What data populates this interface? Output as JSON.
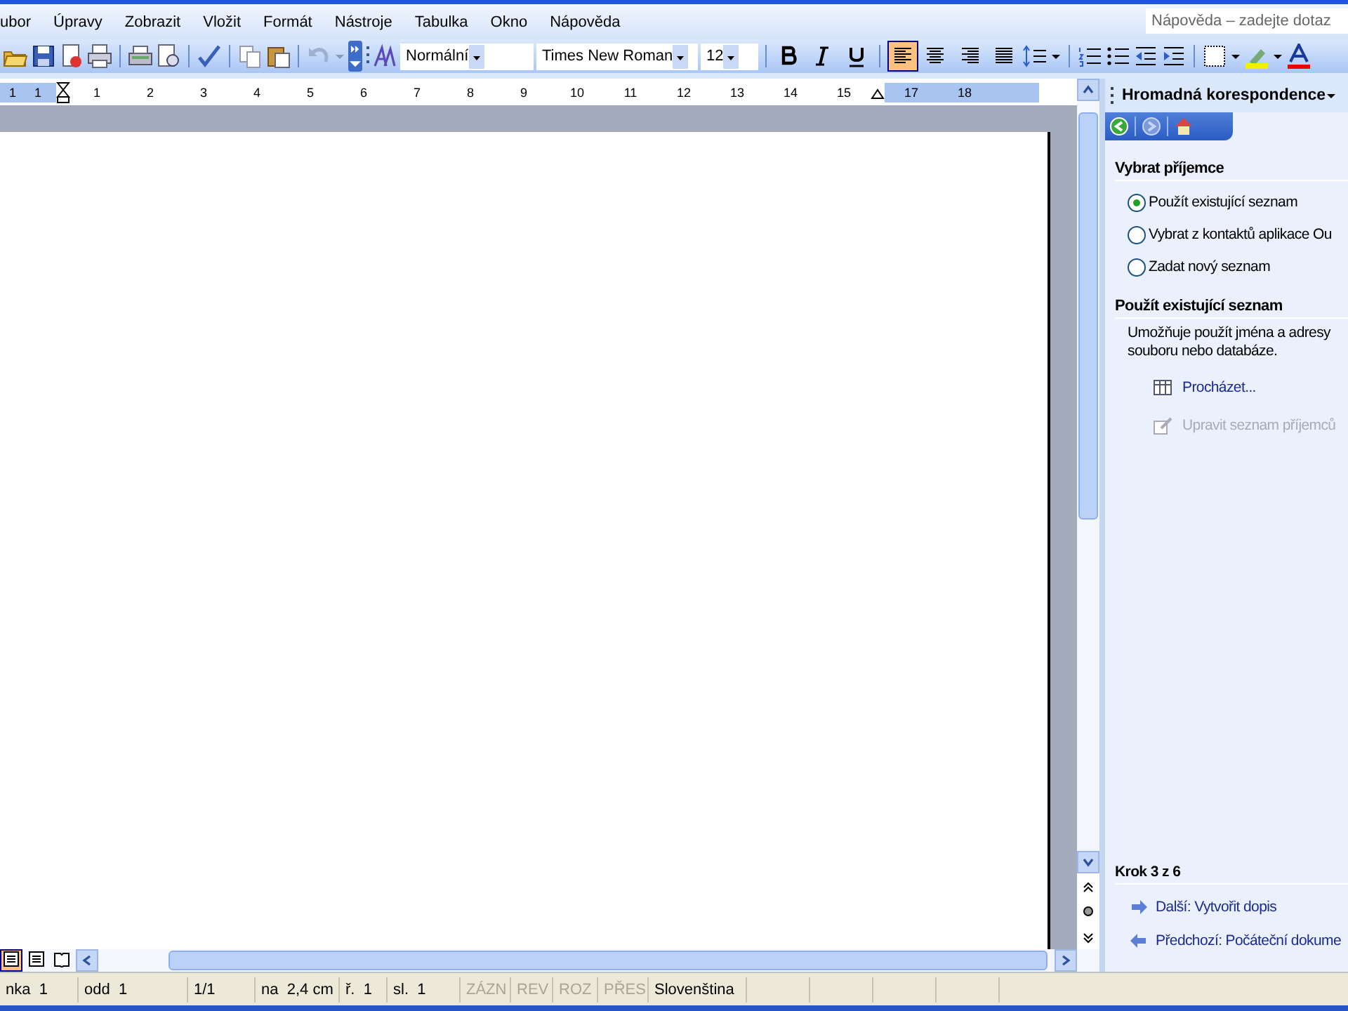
{
  "menu": [
    "ubor",
    "Úpravy",
    "Zobrazit",
    "Vložit",
    "Formát",
    "Nástroje",
    "Tabulka",
    "Okno",
    "Nápověda"
  ],
  "help_box": {
    "placeholder": "Nápověda – zadejte dotaz"
  },
  "toolbar": {
    "style": "Normální",
    "font": "Times New Roman",
    "size": "12",
    "align_buttons": [
      {
        "selected": true
      },
      {
        "selected": false
      },
      {
        "selected": false
      },
      {
        "selected": false
      }
    ]
  },
  "ruler": {
    "left_labels": [
      "1",
      "1"
    ],
    "labels": [
      "1",
      "2",
      "3",
      "4",
      "5",
      "6",
      "7",
      "8",
      "9",
      "10",
      "11",
      "12",
      "13",
      "14",
      "15"
    ],
    "right_labels": [
      "17",
      "18"
    ]
  },
  "task_pane": {
    "title": "Hromadná korespondence",
    "section_1": "Vybrat příjemce",
    "options": [
      {
        "label": "Použít existující seznam",
        "selected": true
      },
      {
        "label": "Vybrat z kontaktů aplikace Ou",
        "selected": false
      },
      {
        "label": "Zadat nový seznam",
        "selected": false
      }
    ],
    "section_2": "Použít existující seznam",
    "description": "Umožňuje použít jména a adresy souboru nebo databáze.",
    "links": [
      {
        "label": "Procházet...",
        "disabled": false
      },
      {
        "label": "Upravit seznam příjemců",
        "disabled": true
      }
    ],
    "step": "Krok 3 z 6",
    "nav": [
      {
        "label": "Další: Vytvořit dopis",
        "kind": "next"
      },
      {
        "label": "Předchozí: Počáteční dokume",
        "kind": "prev"
      }
    ]
  },
  "status_bar": [
    {
      "text": "nka  1",
      "disabled": false
    },
    {
      "text": "odd  1",
      "disabled": false
    },
    {
      "text": "1/1",
      "disabled": false
    },
    {
      "text": "na  2,4 cm",
      "disabled": false
    },
    {
      "text": "ř.  1",
      "disabled": false
    },
    {
      "text": "sl.  1",
      "disabled": false
    },
    {
      "text": "ZÁZN",
      "disabled": true
    },
    {
      "text": "REV",
      "disabled": true
    },
    {
      "text": "ROZ",
      "disabled": true
    },
    {
      "text": "PŘES",
      "disabled": true
    },
    {
      "text": "Slovenština",
      "disabled": false
    }
  ]
}
